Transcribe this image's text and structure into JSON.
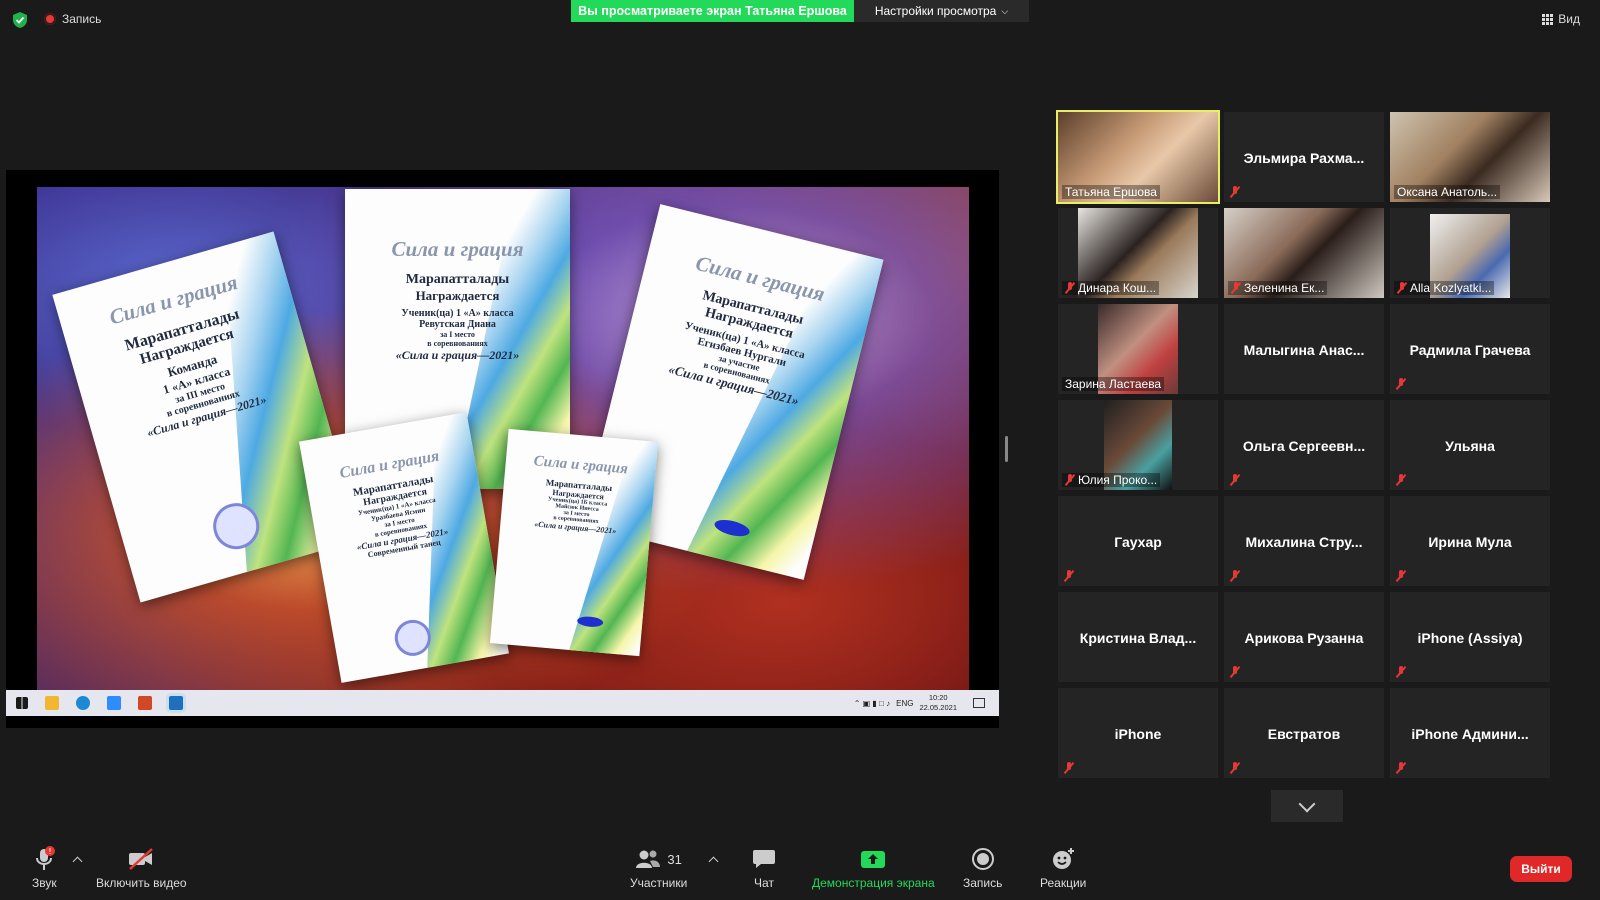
{
  "top": {
    "recording_label": "Запись",
    "share_banner": "Вы просматриваете экран Татьяна Ершова",
    "view_options": "Настройки просмотра",
    "view_label": "Вид"
  },
  "shared_screen": {
    "docs": [
      {
        "title": "Сила и грация",
        "lines": [
          "Марапатталады",
          "Награждается",
          "Команда",
          "1 «А» класса",
          "за III место",
          "в соревнованиях",
          "«Сила и грация—2021»"
        ]
      },
      {
        "title": "Сила и грация",
        "lines": [
          "Марапатталады",
          "Награждается",
          "Ученик(ца) 1 «А» класса",
          "Ревутская Диана",
          "за I место",
          "в соревнованиях",
          "«Сила и грация—2021»"
        ]
      },
      {
        "title": "Сила и грация",
        "lines": [
          "Марапатталады",
          "Награждается",
          "Ученик(ца) 1 «А» класса",
          "Егизбаев Нургали",
          "за участие",
          "в соревнованиях",
          "«Сила и грация—2021»"
        ]
      },
      {
        "title": "Сила и грация",
        "lines": [
          "Марапатталады",
          "Награждается",
          "Ученик(ца) 1 «А» класса",
          "Уразбаева Ясмин",
          "за I место",
          "в соревнованиях",
          "«Сила и грация—2021»",
          "Современный танец"
        ]
      },
      {
        "title": "Сила и грация",
        "lines": [
          "Марапатталады",
          "Награждается",
          "Ученик(ца) 1Б класса",
          "Майсюк Инесса",
          "за I место",
          "в соревнованиях",
          "«Сила и грация—2021»"
        ]
      }
    ],
    "taskbar": {
      "lang": "ENG",
      "time": "10:20",
      "date": "22.05.2021"
    }
  },
  "participants": [
    {
      "name": "Татьяна Ершова",
      "video": true,
      "muted": false,
      "active": true
    },
    {
      "name": "Эльмира  Рахма...",
      "video": false,
      "muted": true
    },
    {
      "name": "Оксана Анатоль...",
      "video": true,
      "muted": false
    },
    {
      "name": "Динара Кош...",
      "video": true,
      "muted": true
    },
    {
      "name": "Зеленина Ек...",
      "video": true,
      "muted": true
    },
    {
      "name": "Alla Kozlyatki...",
      "video": true,
      "muted": true
    },
    {
      "name": "Зарина Ластаева",
      "video": true,
      "muted": false
    },
    {
      "name": "Малыгина  Анас...",
      "video": false,
      "muted": false
    },
    {
      "name": "Радмила Грачева",
      "video": false,
      "muted": true
    },
    {
      "name": "Юлия Проко...",
      "video": true,
      "muted": true
    },
    {
      "name": "Ольга  Сергеевн...",
      "video": false,
      "muted": true
    },
    {
      "name": "Ульяна",
      "video": false,
      "muted": true
    },
    {
      "name": "Гаухар",
      "video": false,
      "muted": true
    },
    {
      "name": "Михалина  Стру...",
      "video": false,
      "muted": true
    },
    {
      "name": "Ирина Мула",
      "video": false,
      "muted": true
    },
    {
      "name": "Кристина  Влад...",
      "video": false,
      "muted": false
    },
    {
      "name": "Арикова Рузанна",
      "video": false,
      "muted": true
    },
    {
      "name": "iPhone (Assiya)",
      "video": false,
      "muted": true
    },
    {
      "name": "iPhone",
      "video": false,
      "muted": true
    },
    {
      "name": "Евстратов",
      "video": false,
      "muted": true
    },
    {
      "name": "iPhone  Админи...",
      "video": false,
      "muted": true
    }
  ],
  "toolbar": {
    "audio_label": "Звук",
    "video_label": "Включить видео",
    "participants_label": "Участники",
    "participants_count": "31",
    "chat_label": "Чат",
    "share_label": "Демонстрация экрана",
    "record_label": "Запись",
    "reactions_label": "Реакции",
    "leave_label": "Выйти"
  },
  "colors": {
    "share_green": "#23d959",
    "active_speaker": "#e9f060",
    "leave_red": "#e02828",
    "muted_red": "#e53935"
  }
}
